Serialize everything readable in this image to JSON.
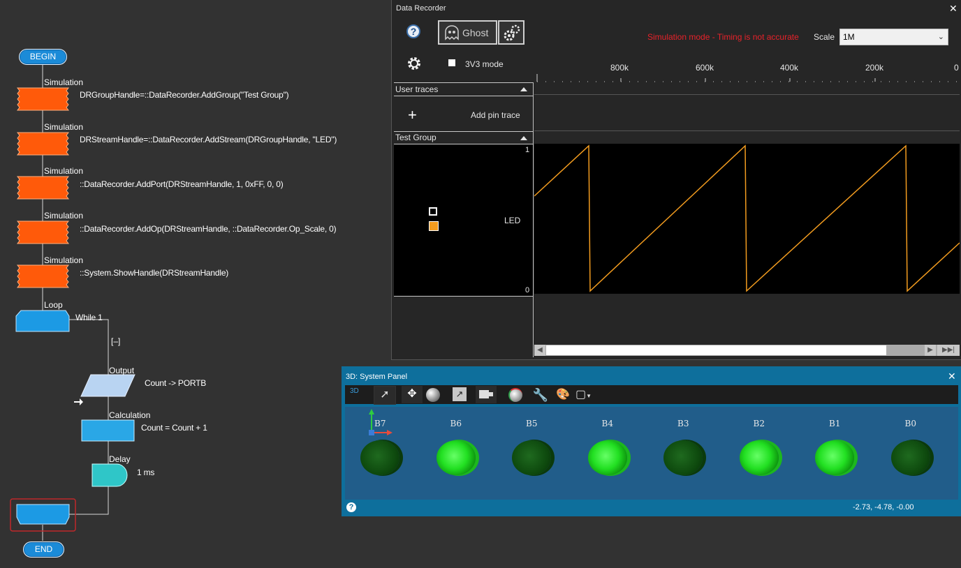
{
  "flowchart": {
    "begin": "BEGIN",
    "end": "END",
    "steps": [
      {
        "caption": "Simulation",
        "text": "DRGroupHandle=::DataRecorder.AddGroup(\"Test Group\")"
      },
      {
        "caption": "Simulation",
        "text": "DRStreamHandle=::DataRecorder.AddStream(DRGroupHandle, \"LED\")"
      },
      {
        "caption": "Simulation",
        "text": "::DataRecorder.AddPort(DRStreamHandle, 1, 0xFF, 0, 0)"
      },
      {
        "caption": "Simulation",
        "text": "::DataRecorder.AddOp(DRStreamHandle, ::DataRecorder.Op_Scale, 0)"
      },
      {
        "caption": "Simulation",
        "text": "::System.ShowHandle(DRStreamHandle)"
      }
    ],
    "loop": {
      "caption": "Loop",
      "text": "While 1",
      "collapse": "[–]"
    },
    "output": {
      "caption": "Output",
      "text": "Count -> PORTB"
    },
    "calculation": {
      "caption": "Calculation",
      "text": "Count = Count + 1"
    },
    "delay": {
      "caption": "Delay",
      "text": "1 ms"
    }
  },
  "data_recorder": {
    "title": "Data Recorder",
    "close": "✕",
    "ghost_label": "Ghost",
    "warning": "Simulation mode - Timing is not accurate",
    "scale_label": "Scale",
    "scale_value": "1M",
    "v3_label": "3V3 mode",
    "ruler": [
      "800k",
      "600k",
      "400k",
      "200k",
      "0"
    ],
    "user_traces": "User traces",
    "add_pin_trace": "Add pin trace",
    "test_group": "Test Group",
    "trace_name": "LED",
    "y_max": "1",
    "y_min": "0",
    "trace_color": "#f39c1f"
  },
  "system_panel": {
    "title": "3D: System Panel",
    "close": "✕",
    "badge_3d": "3D",
    "leds": [
      {
        "label": "B7",
        "on": false
      },
      {
        "label": "B6",
        "on": true
      },
      {
        "label": "B5",
        "on": false
      },
      {
        "label": "B4",
        "on": true
      },
      {
        "label": "B3",
        "on": false
      },
      {
        "label": "B2",
        "on": true
      },
      {
        "label": "B1",
        "on": true
      },
      {
        "label": "B0",
        "on": false
      }
    ],
    "coords": "-2.73, -4.78, -0.00",
    "help": "?"
  }
}
